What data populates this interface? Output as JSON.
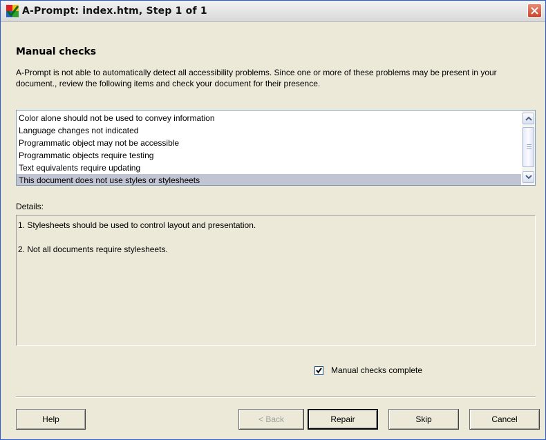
{
  "window": {
    "title": "A-Prompt: index.htm, Step 1 of 1",
    "close_icon": "close-icon"
  },
  "heading": "Manual checks",
  "intro": "A-Prompt is not able to automatically detect all accessibility problems. Since one or more of these problems may be present in your document., review the following items and check your document for their presence.",
  "checks": {
    "items": [
      "Color alone should not be used to convey information",
      "Language changes not indicated",
      "Programmatic object may not be accessible",
      "Programmatic objects require testing",
      "Text equivalents require updating",
      "This document does not use styles or stylesheets"
    ],
    "selected_index": 5
  },
  "details": {
    "label": "Details:",
    "lines": [
      "1. Stylesheets should be used to control layout and presentation.",
      "2. Not all documents require stylesheets."
    ]
  },
  "manual_complete": {
    "label": "Manual checks complete",
    "checked": true
  },
  "buttons": {
    "help": "Help",
    "back": "< Back",
    "repair": "Repair",
    "skip": "Skip",
    "cancel": "Cancel"
  },
  "colors": {
    "selection": "#c1c4d2",
    "dialog_bg": "#ece9d8",
    "close_red": "#c9432c"
  }
}
